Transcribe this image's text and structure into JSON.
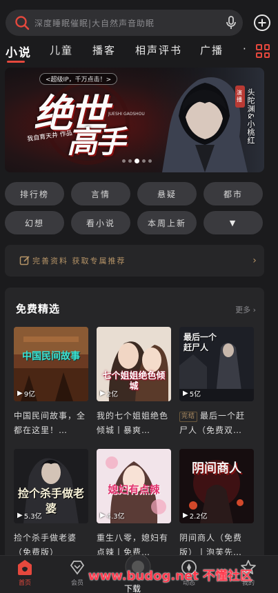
{
  "search": {
    "placeholder": "深度睡眠催眠|大自然声音助眠"
  },
  "tabs": [
    {
      "label": "小说",
      "active": true
    },
    {
      "label": "儿童"
    },
    {
      "label": "播客"
    },
    {
      "label": "相声评书"
    },
    {
      "label": "广播"
    },
    {
      "label": "·"
    }
  ],
  "banner": {
    "tag": "<超级IP，千万点击！>",
    "title_line1": "绝世",
    "title_line2": "高手",
    "author": "我自育天井 作品",
    "english": "JUESHI GAOSHOU",
    "cast_badge": "演播",
    "cast": "头陀渊&小桃红",
    "slide_index": 2,
    "slide_count": 5
  },
  "categories": [
    "排行榜",
    "言情",
    "悬疑",
    "都市",
    "幻想",
    "看小说",
    "本周上新",
    "▼"
  ],
  "prefs_bar": {
    "text": "完善资料 获取专属推荐",
    "chevron": "›"
  },
  "free_section": {
    "title": "免费精选",
    "more": "更多 ›",
    "books": [
      {
        "title": "中国民间故事，全都在这里！…",
        "plays": "9亿",
        "cover_text": "中国民间故事"
      },
      {
        "title": "我的七个姐姐绝色倾城丨暴爽…",
        "plays": "2亿",
        "cover_text": "七个姐姐绝色倾城"
      },
      {
        "title": "最后一个赶尸人（免费双…",
        "plays": "5亿",
        "badge": "完结",
        "cover_text": "最后一个赶尸人"
      },
      {
        "title": "捡个杀手做老婆（免费版）",
        "plays": "5.3亿",
        "cover_text": "捡个杀手做老婆"
      },
      {
        "title": "重生八零，媳妇有点辣丨免费…",
        "plays": "4.3亿",
        "cover_text": "媳妇有点辣"
      },
      {
        "title": "阴间商人（免费版）丨泡芙先…",
        "plays": "2.2亿",
        "cover_text": "阴间商人"
      }
    ]
  },
  "bottom_nav": [
    {
      "label": "首页",
      "icon": "home-icon",
      "active": true
    },
    {
      "label": "会员",
      "icon": "vip-diamond-icon"
    },
    {
      "label": "",
      "icon": "center-play-icon"
    },
    {
      "label": "动态",
      "icon": "discover-icon"
    },
    {
      "label": "我的",
      "icon": "profile-star-icon"
    }
  ],
  "watermark": {
    "url": "www.budog.net",
    "cn": "不懂社区",
    "overlay": "下载"
  },
  "colors": {
    "accent": "#e5483d",
    "gold": "#b69467",
    "bg": "#1b1b1d",
    "card": "#262628",
    "chip": "#3a3a3e"
  }
}
